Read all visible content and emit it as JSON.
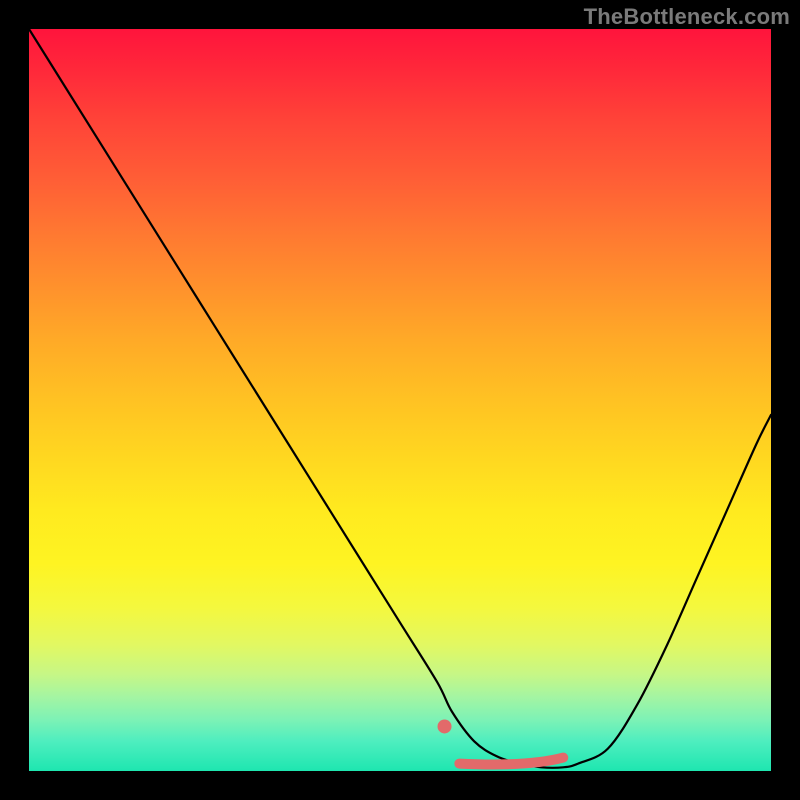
{
  "watermark": "TheBottleneck.com",
  "chart_data": {
    "type": "line",
    "title": "",
    "xlabel": "",
    "ylabel": "",
    "xlim": [
      0,
      100
    ],
    "ylim": [
      0,
      100
    ],
    "x": [
      0,
      5,
      10,
      15,
      20,
      25,
      30,
      35,
      40,
      45,
      50,
      55,
      57,
      60,
      63,
      66,
      69,
      72,
      74,
      78,
      82,
      86,
      90,
      94,
      98,
      100
    ],
    "values": [
      100,
      92,
      84,
      76,
      68,
      60,
      52,
      44,
      36,
      28,
      20,
      12,
      8,
      4,
      2,
      1,
      0.5,
      0.5,
      1,
      3,
      9,
      17,
      26,
      35,
      44,
      48
    ],
    "series": [
      {
        "name": "curve",
        "color": "#000000",
        "stroke_width": 2
      }
    ],
    "highlight": {
      "color": "#e26a6a",
      "dot": {
        "x": 56,
        "y": 6
      },
      "segment_x": [
        58,
        72
      ],
      "segment_y": 1,
      "stroke_width": 10
    },
    "background_gradient": {
      "top": "#ff143c",
      "mid": "#ffea1f",
      "bottom": "#1ee6b0"
    }
  }
}
